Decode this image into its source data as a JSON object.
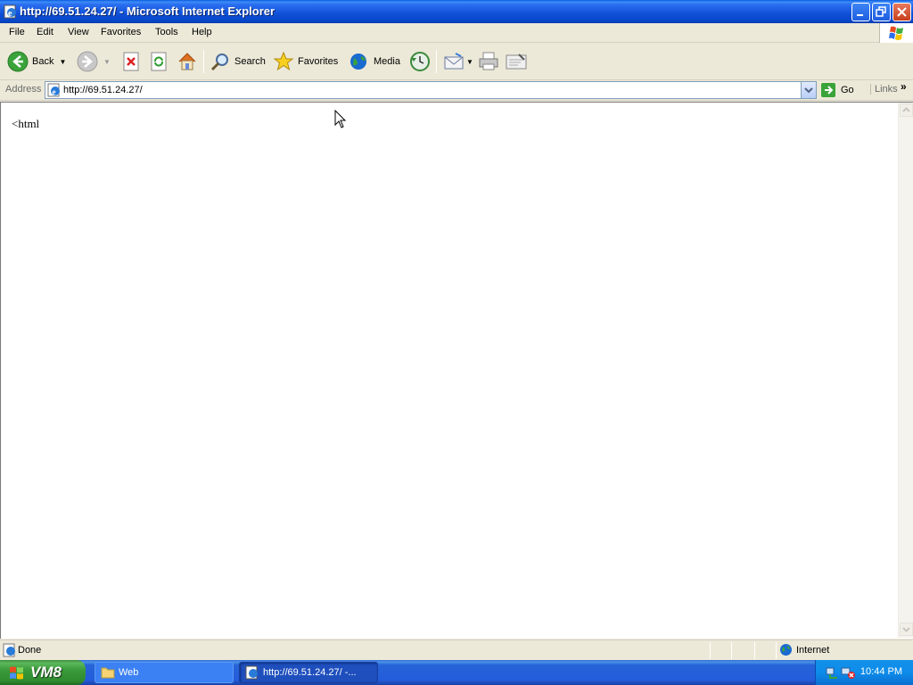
{
  "window": {
    "title": "http://69.51.24.27/ - Microsoft Internet Explorer"
  },
  "menu": {
    "items": [
      "File",
      "Edit",
      "View",
      "Favorites",
      "Tools",
      "Help"
    ]
  },
  "toolbar": {
    "back_label": "Back",
    "search_label": "Search",
    "favorites_label": "Favorites",
    "media_label": "Media"
  },
  "address": {
    "label": "Address",
    "url": "http://69.51.24.27/",
    "go_label": "Go",
    "links_label": "Links"
  },
  "page": {
    "text": "<html"
  },
  "status": {
    "text": "Done",
    "zone": "Internet"
  },
  "taskbar": {
    "start_label": "VM8",
    "tasks": [
      "Web",
      "http://69.51.24.27/ -..."
    ],
    "clock": "10:44 PM"
  },
  "colors": {
    "titlebar": "#0a5be0",
    "taskbar": "#245ddb",
    "start": "#3a9a3a"
  }
}
